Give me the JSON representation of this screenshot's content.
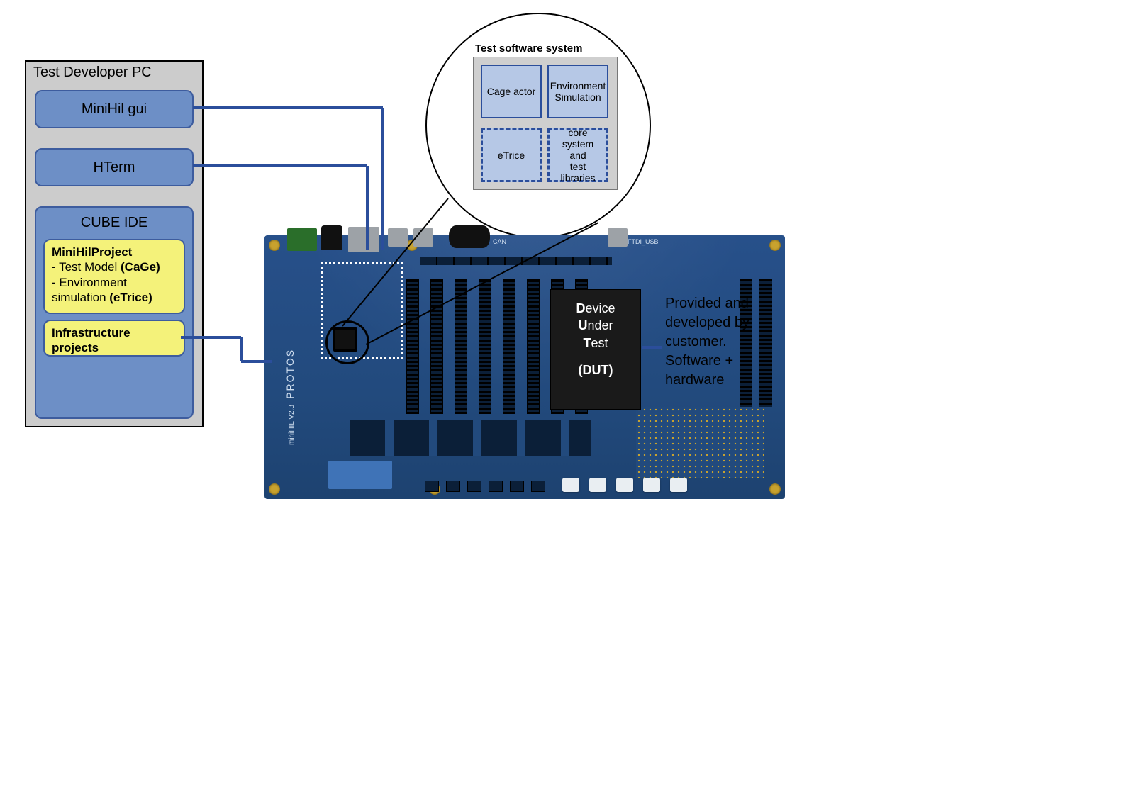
{
  "pc_panel": {
    "title": "Test Developer PC",
    "minihil": "MiniHil gui",
    "hterm": "HTerm",
    "cubeide_title": "CUBE IDE",
    "mhp_title": "MiniHilProject",
    "mhp_l1a": "- Test Model ",
    "mhp_l1b": "(CaGe)",
    "mhp_l2a": "- Environment",
    "mhp_l2b": "  simulation ",
    "mhp_l2c": "(eTrice)",
    "infra_l1": "Infrastructure",
    "infra_l2": "projects"
  },
  "board": {
    "brand": "PROTOS",
    "model": "miniHIL V2.3",
    "can_label": "CAN",
    "usb_label": "FTDI_USB"
  },
  "callout": {
    "title": "Test software system",
    "cage": "Cage actor",
    "env1": "Environment",
    "env2": "Simulation",
    "etrice": "eTrice",
    "core1": "core system",
    "core2": "and",
    "core3": "test libraries"
  },
  "dut": {
    "d": "D",
    "device": "evice",
    "u": "U",
    "under": "nder",
    "t": "T",
    "test": "est",
    "acronym": "(DUT)"
  },
  "dut_desc": {
    "l1": "Provided and",
    "l2": "developed by",
    "l3": "customer.",
    "l4": "Software +",
    "l5": "hardware"
  }
}
